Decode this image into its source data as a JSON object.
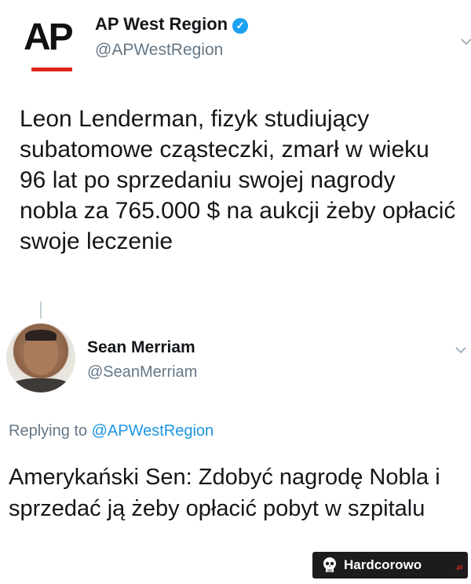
{
  "tweet1": {
    "logo_text": "AP",
    "name": "AP West Region",
    "verified_glyph": "✓",
    "handle": "@APWestRegion",
    "text": "Leon Lenderman, fizyk studiujący subatomowe cząsteczki, zmarł w wieku 96 lat po sprzedaniu swojej nagrody nobla za 765.000 $ na aukcji żeby opłacić swoje leczenie",
    "menu_icon": "chevron-down-icon"
  },
  "tweet2": {
    "name": "Sean Merriam",
    "handle": "@SeanMerriam",
    "replying_prefix": "Replying to",
    "replying_mention": "@APWestRegion",
    "text": "Amerykański Sen: Zdobyć nagrodę Nobla i sprzedać ją żeby opłacić pobyt w szpitalu",
    "menu_icon": "chevron-down-icon"
  },
  "watermark": {
    "text": "Hardcorowo",
    "tld": ".pl"
  },
  "colors": {
    "verified_blue": "#1da1f2",
    "mention_blue": "#1b95e0",
    "secondary_text": "#657786",
    "ap_red": "#e0251b"
  }
}
